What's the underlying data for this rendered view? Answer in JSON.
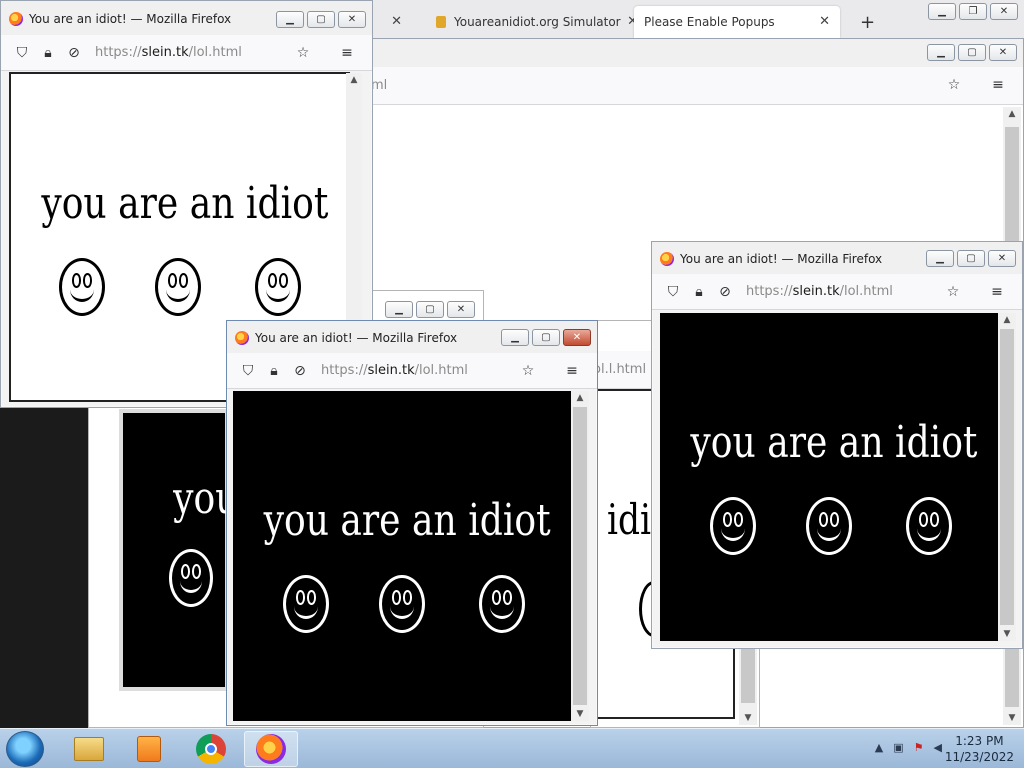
{
  "main_window": {
    "tabs": [
      {
        "label": ""
      },
      {
        "label": "Youareanidiot.org Simulator"
      },
      {
        "label": "Please Enable Popups"
      }
    ],
    "new_tab_glyph": "+",
    "url_fragment": "ml"
  },
  "popup_title": "You are an idiot! — Mozilla Firefox",
  "popup_url_host": "slein.tk",
  "popup_url_prefix": "https://",
  "popup_url_path": "/lol.html",
  "popup_text": "you are an idiot",
  "behind_url_fragment": "ol.l.html",
  "behind_text_fragment": "you",
  "behind_text_fragment2": "idi",
  "taskbar": {
    "time": "1:23 PM",
    "date": "11/23/2022"
  },
  "colors": {
    "titlebar": "#f0f0f0",
    "close_red": "#c24a30",
    "taskbar": "#9bb8d8"
  }
}
